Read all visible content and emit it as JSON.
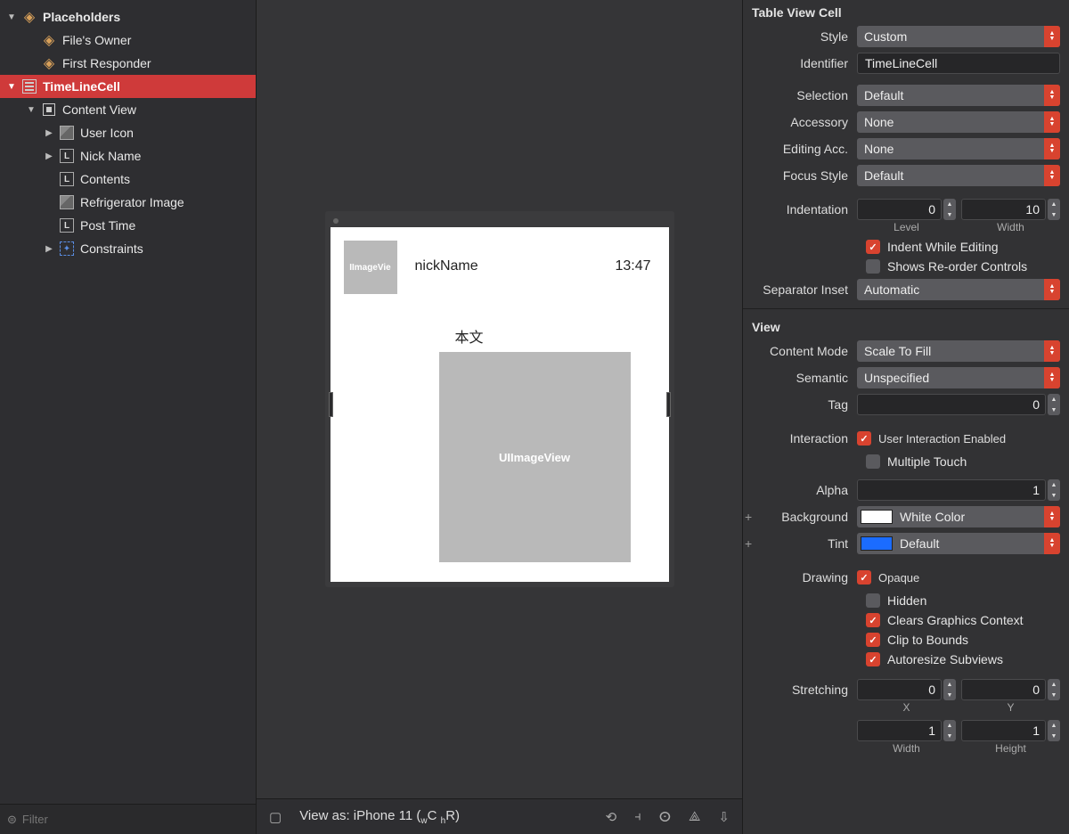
{
  "outline": {
    "placeholders_label": "Placeholders",
    "files_owner": "File's Owner",
    "first_responder": "First Responder",
    "timeline_cell": "TimeLineCell",
    "content_view": "Content View",
    "user_icon": "User Icon",
    "nick_name": "Nick Name",
    "contents": "Contents",
    "refrigerator_image": "Refrigerator Image",
    "post_time": "Post Time",
    "constraints": "Constraints",
    "filter_placeholder": "Filter"
  },
  "preview": {
    "user_icon_text": "IImageVie",
    "nick_name": "nickName",
    "time": "13:47",
    "contents": "本文",
    "imageview_text": "UIImageView"
  },
  "canvas_footer": {
    "view_as": "View as: iPhone 11 (",
    "wc": "C ",
    "hr": "R)",
    "wprefix": "w",
    "hprefix": "h"
  },
  "inspector": {
    "cell_section": "Table View Cell",
    "style_label": "Style",
    "style_value": "Custom",
    "identifier_label": "Identifier",
    "identifier_value": "TimeLineCell",
    "selection_label": "Selection",
    "selection_value": "Default",
    "accessory_label": "Accessory",
    "accessory_value": "None",
    "editing_acc_label": "Editing Acc.",
    "editing_acc_value": "None",
    "focus_style_label": "Focus Style",
    "focus_style_value": "Default",
    "indentation_label": "Indentation",
    "indentation_level": "0",
    "indentation_width": "10",
    "indentation_level_sub": "Level",
    "indentation_width_sub": "Width",
    "indent_while_editing": "Indent While Editing",
    "shows_reorder": "Shows Re-order Controls",
    "separator_inset_label": "Separator Inset",
    "separator_inset_value": "Automatic",
    "view_section": "View",
    "content_mode_label": "Content Mode",
    "content_mode_value": "Scale To Fill",
    "semantic_label": "Semantic",
    "semantic_value": "Unspecified",
    "tag_label": "Tag",
    "tag_value": "0",
    "interaction_label": "Interaction",
    "user_interaction": "User Interaction Enabled",
    "multiple_touch": "Multiple Touch",
    "alpha_label": "Alpha",
    "alpha_value": "1",
    "background_label": "Background",
    "background_value": "White Color",
    "tint_label": "Tint",
    "tint_value": "Default",
    "drawing_label": "Drawing",
    "opaque": "Opaque",
    "hidden": "Hidden",
    "clears_ctx": "Clears Graphics Context",
    "clip_bounds": "Clip to Bounds",
    "autoresize": "Autoresize Subviews",
    "stretching_label": "Stretching",
    "stretch_x": "0",
    "stretch_y": "0",
    "stretch_x_sub": "X",
    "stretch_y_sub": "Y",
    "stretch_w": "1",
    "stretch_h": "1",
    "stretch_w_sub": "Width",
    "stretch_h_sub": "Height"
  }
}
